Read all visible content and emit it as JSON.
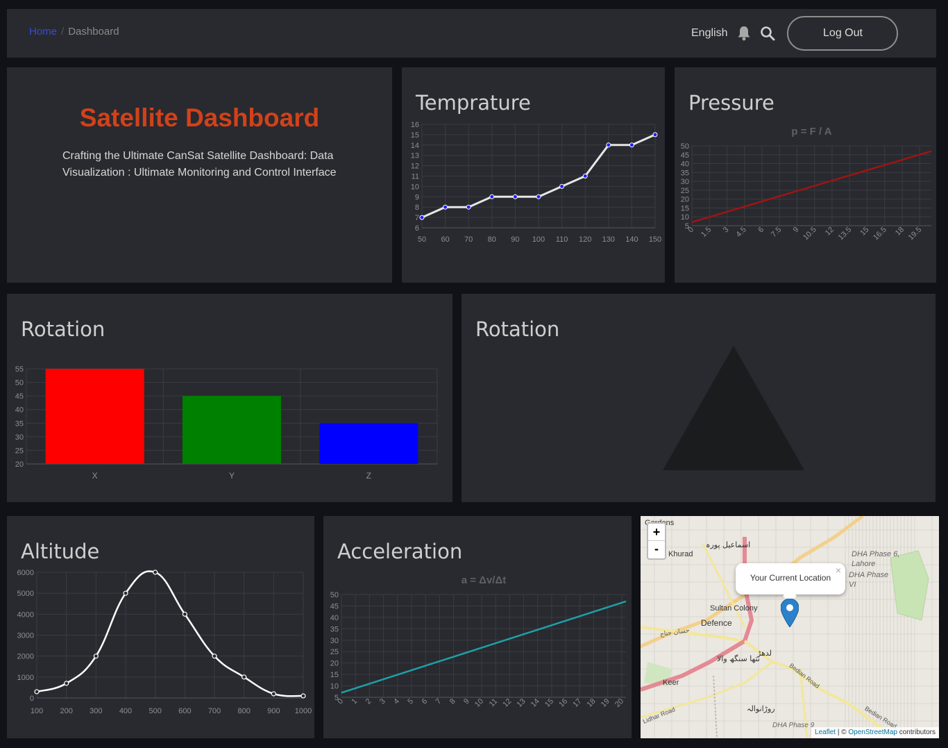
{
  "nav": {
    "breadcrumb_home": "Home",
    "breadcrumb_sep": "/",
    "breadcrumb_current": "Dashboard",
    "language": "English",
    "logout_label": "Log Out",
    "icons": [
      "bell-icon",
      "search-icon"
    ]
  },
  "hero": {
    "title": "Satellite Dashboard",
    "subtitle": "Crafting the Ultimate CanSat Satellite Dashboard: Data Visualization : Ultimate Monitoring and Control Interface",
    "title_color": "#d2411a"
  },
  "cards": {
    "temperature": "Temprature",
    "pressure": "Pressure",
    "rotation_bar": "Rotation",
    "rotation_3d": "Rotation",
    "altitude": "Altitude",
    "acceleration": "Acceleration"
  },
  "map": {
    "popup": "Your Current Location",
    "popup_close": "×",
    "zoom_in": "+",
    "zoom_out": "-",
    "attrib_leaflet": "Leaflet",
    "attrib_sep": " | © ",
    "attrib_osm": "OpenStreetMap",
    "attrib_tail": " contributors",
    "labels": [
      "Gardens",
      "Khurad",
      "اسماعیل پورہ",
      "DHA Phase 6, Lahore",
      "DHA Phase VI",
      "Sultan Colony",
      "Defence",
      "لدھڑ",
      "نتھا سنگھ والا",
      "Keer",
      "روڑانوالہ",
      "DHA Phase 9",
      "Bedian Road",
      "Bedian Road",
      "Lidhar Road",
      "حسان جناح"
    ]
  },
  "chart_data": [
    {
      "id": "temperature",
      "type": "line",
      "x": [
        50,
        60,
        70,
        80,
        90,
        100,
        110,
        120,
        130,
        140,
        150
      ],
      "values": [
        7,
        8,
        8,
        9,
        9,
        9,
        10,
        11,
        14,
        14,
        15
      ],
      "ylim": [
        6,
        16
      ],
      "yticks": [
        6,
        7,
        8,
        9,
        10,
        11,
        12,
        13,
        14,
        15,
        16
      ],
      "line_color": "#e6e6e6",
      "point_color": "#2020ff",
      "grid": true
    },
    {
      "id": "pressure",
      "type": "line",
      "title": "p = F / A",
      "x": [
        0,
        1.5,
        3,
        4.5,
        6,
        7.5,
        9,
        10.5,
        12,
        13.5,
        15,
        16.5,
        18,
        19.5
      ],
      "x_end": 20.5,
      "y_start": 7,
      "y_end": 47,
      "ylim": [
        5,
        50
      ],
      "yticks": [
        5,
        10,
        15,
        20,
        25,
        30,
        35,
        40,
        45,
        50
      ],
      "line_color": "#a01414",
      "grid": true
    },
    {
      "id": "rotation",
      "type": "bar",
      "categories": [
        "X",
        "Y",
        "Z"
      ],
      "values": [
        55,
        45,
        35
      ],
      "colors": [
        "#ff0000",
        "#008000",
        "#0000ff"
      ],
      "ylim": [
        20,
        55
      ],
      "yticks": [
        20,
        25,
        30,
        35,
        40,
        45,
        50,
        55
      ],
      "grid": true
    },
    {
      "id": "altitude",
      "type": "line",
      "x": [
        100,
        200,
        300,
        400,
        500,
        600,
        700,
        800,
        900,
        1000
      ],
      "values": [
        300,
        700,
        2000,
        5000,
        6000,
        4000,
        2000,
        1000,
        200,
        100
      ],
      "ylim": [
        0,
        6000
      ],
      "yticks": [
        0,
        1000,
        2000,
        3000,
        4000,
        5000,
        6000
      ],
      "line_color": "#ffffff",
      "grid": true
    },
    {
      "id": "acceleration",
      "type": "line",
      "title": "a = Δv/Δt",
      "x": [
        0,
        1,
        2,
        3,
        4,
        5,
        6,
        7,
        8,
        9,
        10,
        11,
        12,
        13,
        14,
        15,
        16,
        17,
        18,
        19,
        20
      ],
      "x_end": 20.3,
      "y_start": 7,
      "y_end": 47,
      "ylim": [
        5,
        50
      ],
      "yticks": [
        5,
        10,
        15,
        20,
        25,
        30,
        35,
        40,
        45,
        50
      ],
      "line_color": "#1ea0a8",
      "grid": true
    }
  ]
}
